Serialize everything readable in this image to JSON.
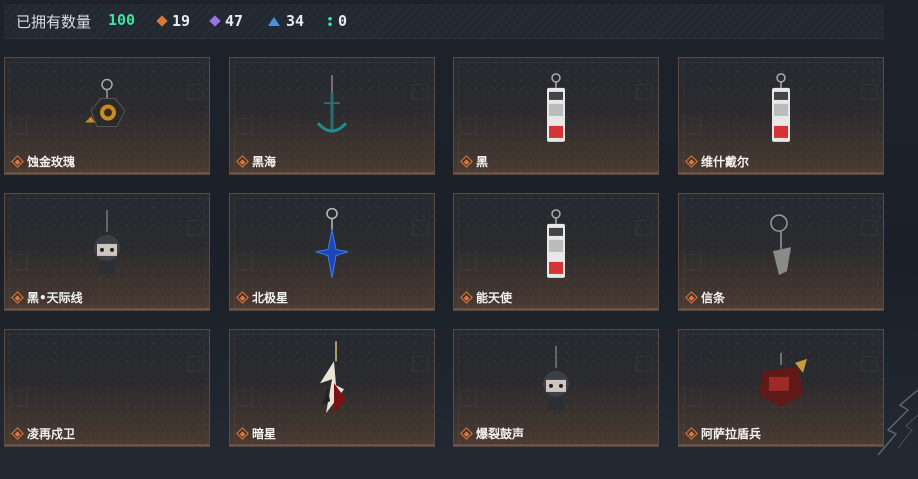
{
  "header": {
    "owned_label": "已拥有数量",
    "owned_count": "100",
    "stats": [
      {
        "icon": "orange-diamond-icon",
        "value": "19",
        "color": "#d9783a"
      },
      {
        "icon": "purple-diamond-icon",
        "value": "47",
        "color": "#9b72e8"
      },
      {
        "icon": "blue-triangle-icon",
        "value": "34",
        "color": "#4d8fd8"
      },
      {
        "icon": "green-dots-icon",
        "value": "0",
        "color": "#3fe0a0"
      }
    ]
  },
  "items": [
    {
      "name": "蚀金玫瑰",
      "art": "rose-charm"
    },
    {
      "name": "黑海",
      "art": "anchor-charm"
    },
    {
      "name": "黑",
      "art": "tag-charm"
    },
    {
      "name": "维什戴尔",
      "art": "tag-charm"
    },
    {
      "name": "黑•天际线",
      "art": "doll-charm"
    },
    {
      "name": "北极星",
      "art": "star-charm"
    },
    {
      "name": "能天使",
      "art": "tag-charm"
    },
    {
      "name": "信条",
      "art": "hook-charm"
    },
    {
      "name": "凌再戍卫",
      "art": "none"
    },
    {
      "name": "暗星",
      "art": "blade-charm"
    },
    {
      "name": "爆裂鼓声",
      "art": "doll-charm"
    },
    {
      "name": "阿萨拉盾兵",
      "art": "shield-charm"
    }
  ],
  "rarity_color": "#e07a3c"
}
